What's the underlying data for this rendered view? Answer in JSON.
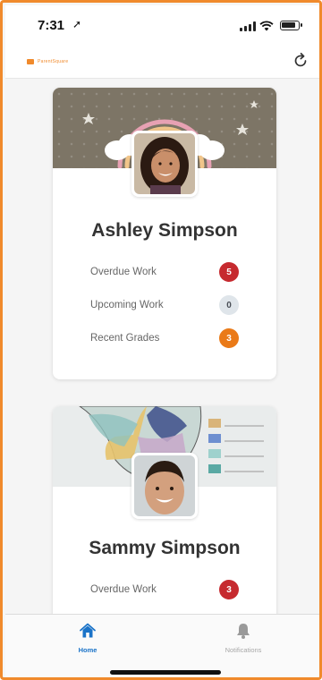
{
  "status_bar": {
    "time": "7:31",
    "location_glyph": "➚"
  },
  "header": {
    "logo_text": "ParentSquare",
    "refresh_icon": "refresh-icon"
  },
  "students": [
    {
      "name": "Ashley Simpson",
      "rows": [
        {
          "label": "Overdue Work",
          "count": "5",
          "color": "#c62a2f"
        },
        {
          "label": "Upcoming Work",
          "count": "0",
          "color": "#dfe5ea"
        },
        {
          "label": "Recent Grades",
          "count": "3",
          "color": "#ea7a18"
        }
      ]
    },
    {
      "name": "Sammy Simpson",
      "rows": [
        {
          "label": "Overdue Work",
          "count": "3",
          "color": "#c62a2f"
        }
      ]
    }
  ],
  "tabs": [
    {
      "label": "Home",
      "icon": "home-icon",
      "active": true
    },
    {
      "label": "Notifications",
      "icon": "bell-icon",
      "active": false
    }
  ],
  "colors": {
    "accent": "#f08a2c",
    "active_tab": "#1a73c8"
  }
}
